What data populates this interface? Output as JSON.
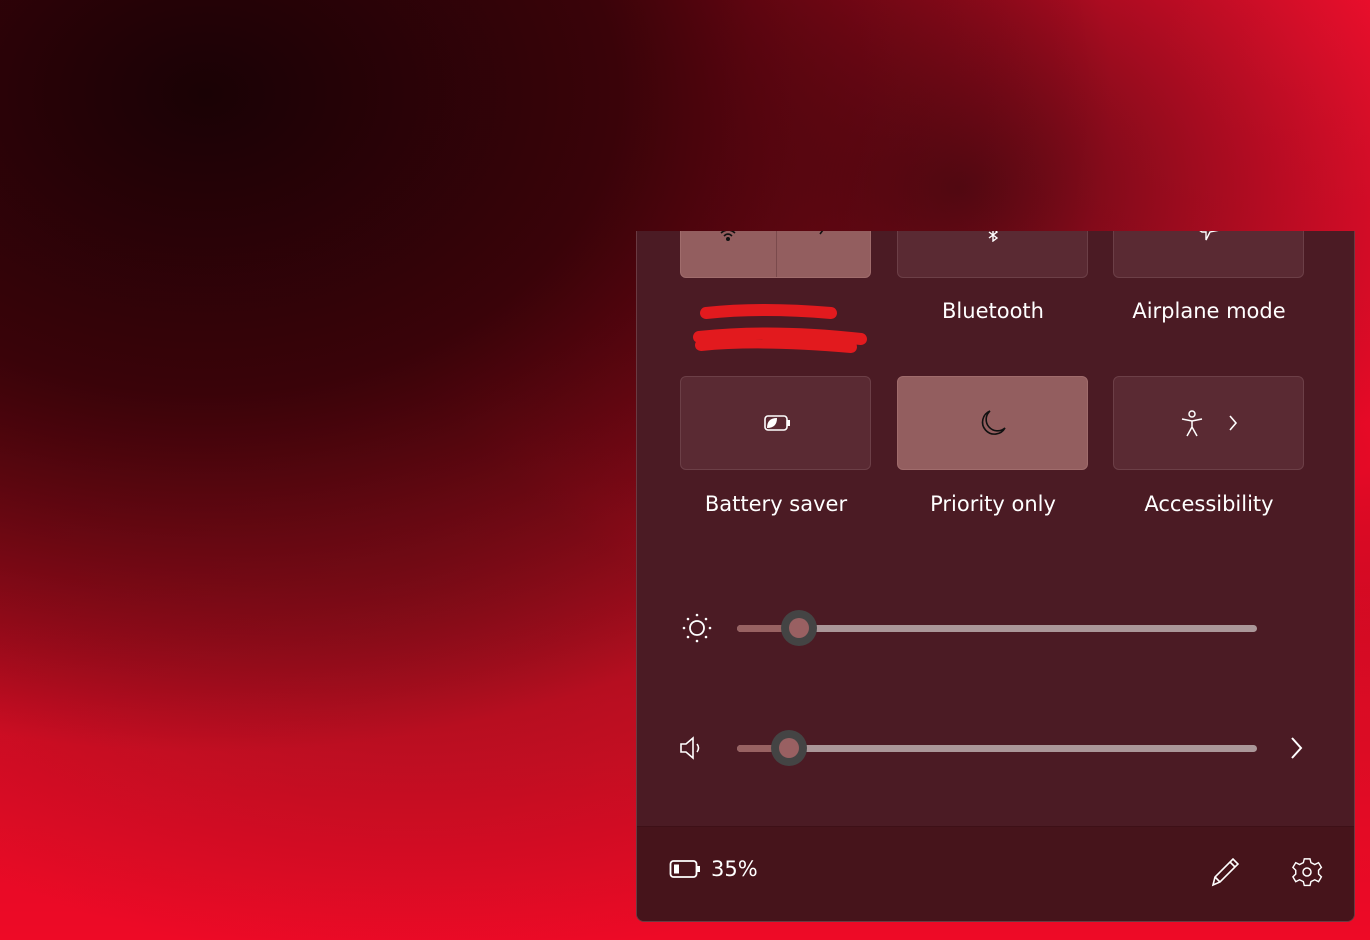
{
  "quick_settings": {
    "tiles": [
      {
        "label": "[redacted]",
        "icon": "wifi-icon",
        "active": true
      },
      {
        "label": "Bluetooth",
        "icon": "bluetooth-icon",
        "active": false
      },
      {
        "label": "Airplane mode",
        "icon": "airplane-icon",
        "active": false
      },
      {
        "label": "Battery saver",
        "icon": "battery-saver-icon",
        "active": false
      },
      {
        "label": "Priority only",
        "icon": "moon-icon",
        "active": true
      },
      {
        "label": "Accessibility",
        "icon": "accessibility-icon",
        "active": false
      }
    ],
    "brightness_percent": 12,
    "volume_percent": 10
  },
  "footer": {
    "battery": "35%"
  },
  "colors": {
    "panel": "#4b1b24",
    "active_tile": "#935e5f",
    "footer": "#46141b"
  }
}
